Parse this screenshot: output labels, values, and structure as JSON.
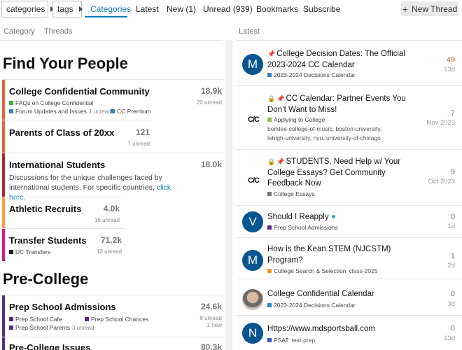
{
  "nav": {
    "dropdown_categories": "categories",
    "dropdown_tags": "tags",
    "tabs": [
      "Categories",
      "Latest",
      "New (1)",
      "Unread (939)",
      "Bookmarks",
      "Subscribe"
    ],
    "new_thread": "New Thread"
  },
  "columns": {
    "category": "Category",
    "threads": "Threads",
    "latest": "Latest"
  },
  "sections": {
    "find": {
      "title": "Find Your People",
      "categories": [
        {
          "name": "College Confidential Community",
          "count": "18.9k",
          "unread": "20 unread",
          "color": "#e8653b",
          "subs": [
            {
              "name": "FAQs on College Confidential",
              "color": "#3ab54a",
              "unread": ""
            },
            {
              "name": "Forum Updates and Issues",
              "color": "#2e86c1",
              "unread": "1 unread"
            },
            {
              "name": "CC Premium",
              "color": "#2e86c1",
              "unread": ""
            }
          ]
        },
        {
          "name": "Parents of Class of 20xx",
          "count": "121",
          "unread": "7 unread",
          "color": "#e8653b"
        },
        {
          "name": "International Students",
          "count": "18.0k",
          "unread": "",
          "color": "#b7282e",
          "desc": "Discussions for the unique challenges faced by international students. For specific countries, ",
          "desc_link": "click here."
        },
        {
          "name": "Athletic Recruits",
          "count": "4.0k",
          "unread": "16 unread",
          "color": "#f7a13b"
        },
        {
          "name": "Transfer Students",
          "count": "71.2k",
          "unread": "13 unread",
          "color": "#e0197d",
          "subs": [
            {
              "name": "UC Transfers",
              "color": "#222",
              "unread": ""
            }
          ]
        }
      ]
    },
    "precollege": {
      "title": "Pre-College",
      "categories": [
        {
          "name": "Prep School Admissions",
          "count": "24.6k",
          "unread": "8 unread",
          "new": "1 new",
          "color": "#5b2a86",
          "subs": [
            {
              "name": "Prep School Cafe",
              "color": "#5b2a86",
              "unread": ""
            },
            {
              "name": "Prep School Chances",
              "color": "#5b2a86",
              "unread": ""
            },
            {
              "name": "Prep School Parents",
              "color": "#5b2a86",
              "unread": "3 unread"
            }
          ]
        },
        {
          "name": "Pre-College Issues",
          "count": "80.3k",
          "color": "#5b2a86"
        }
      ]
    }
  },
  "topics": [
    {
      "avatar": "M",
      "avatar_color": "#08558f",
      "pinned": true,
      "locked": false,
      "title": "College Decision Dates: The Official 2023-2024 CC Calendar",
      "category": "2023-2024 Decisions Calendar",
      "cat_color": "#2e86c1",
      "tags": "",
      "replies": "49",
      "date": "13d",
      "hot": true
    },
    {
      "avatar": "CC",
      "pinned": true,
      "locked": true,
      "title": "CC Calendar: Partner Events You Don’t Want to Miss!",
      "category": "Applying to College",
      "cat_color": "#8bc34a",
      "tags": "berklee-college-of-music, boston-university, lehigh-university, nyu, university-of-chicago",
      "replies": "7",
      "date": "Nov 2023"
    },
    {
      "avatar": "CC",
      "pinned": true,
      "locked": true,
      "title": "STUDENTS, Need Help w/ Your College Essays? Get Community Feedback Now",
      "category": "College Essays",
      "cat_color": "#777",
      "tags": "",
      "replies": "9",
      "date": "Oct 2023"
    },
    {
      "avatar": "V",
      "avatar_color": "#08558f",
      "title": "Should I Reapply",
      "category": "Prep School Admissions",
      "cat_color": "#5b2a86",
      "tags": "",
      "replies": "0",
      "date": "1d",
      "new_dot": true
    },
    {
      "avatar": "M",
      "avatar_color": "#08558f",
      "title": "How is the Kean STEM (NJCSTM) Program?",
      "category": "College Search & Selection",
      "cat_color": "#f7941d",
      "tag": "class-2025",
      "replies": "1",
      "date": "2d"
    },
    {
      "avatar": "photo",
      "title": "College Confidential Calendar",
      "category": "2023-2024 Decisions Calendar",
      "cat_color": "#2e86c1",
      "tags": "",
      "replies": "0",
      "date": "3d"
    },
    {
      "avatar": "N",
      "avatar_color": "#08558f",
      "title": "Https://www.mdsportsball.com",
      "category": "PSAT",
      "cat_color": "#3f51b5",
      "tag": "test-prep",
      "replies": "0",
      "date": "13d"
    }
  ]
}
